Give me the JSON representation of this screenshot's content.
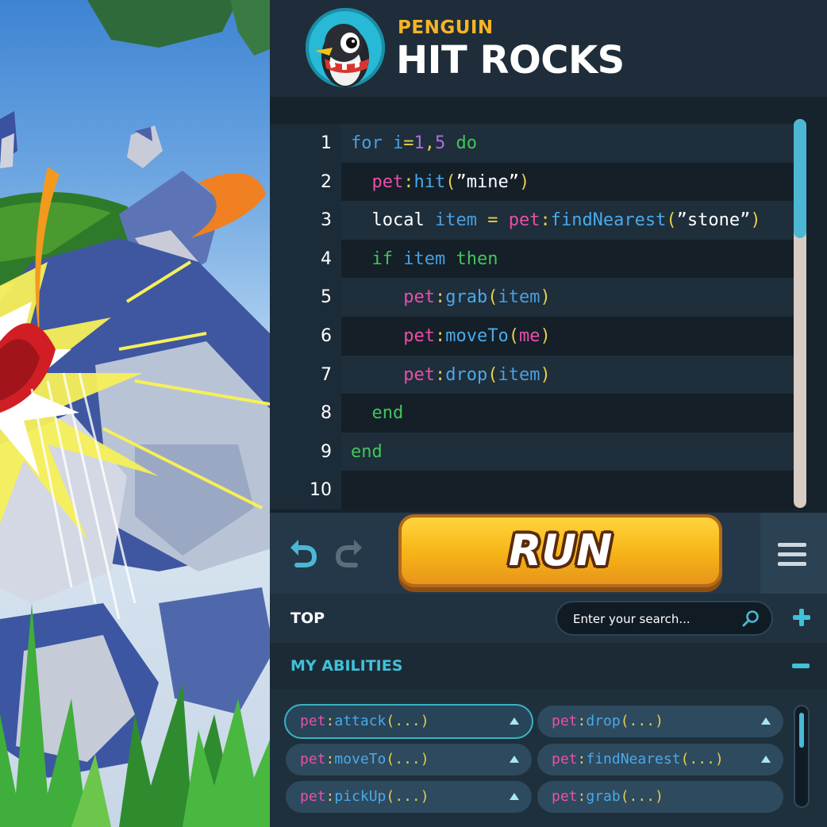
{
  "header": {
    "subtitle": "PENGUIN",
    "title": "HIT ROCKS",
    "avatar_icon": "penguin-avatar-icon"
  },
  "editor": {
    "lines": [
      {
        "num": "1",
        "tokens": [
          [
            "for",
            "for"
          ],
          [
            "plain",
            " "
          ],
          [
            "var",
            "i"
          ],
          [
            "punc",
            "="
          ],
          [
            "num",
            "1"
          ],
          [
            "punc",
            ","
          ],
          [
            "num",
            "5"
          ],
          [
            "plain",
            " "
          ],
          [
            "kw",
            "do"
          ]
        ]
      },
      {
        "num": "2",
        "tokens": [
          [
            "plain",
            "  "
          ],
          [
            "pet",
            "pet"
          ],
          [
            "punc",
            ":"
          ],
          [
            "fn",
            "hit"
          ],
          [
            "punc",
            "("
          ],
          [
            "str",
            "”mine”"
          ],
          [
            "punc",
            ")"
          ]
        ]
      },
      {
        "num": "3",
        "tokens": [
          [
            "plain",
            "  local "
          ],
          [
            "var",
            "item"
          ],
          [
            "plain",
            " "
          ],
          [
            "punc",
            "="
          ],
          [
            "plain",
            " "
          ],
          [
            "pet",
            "pet"
          ],
          [
            "punc",
            ":"
          ],
          [
            "fn",
            "findNearest"
          ],
          [
            "punc",
            "("
          ],
          [
            "str",
            "”stone”"
          ],
          [
            "punc",
            ")"
          ]
        ]
      },
      {
        "num": "4",
        "tokens": [
          [
            "plain",
            "  "
          ],
          [
            "kw",
            "if"
          ],
          [
            "plain",
            " "
          ],
          [
            "var",
            "item"
          ],
          [
            "plain",
            " "
          ],
          [
            "kw",
            "then"
          ]
        ]
      },
      {
        "num": "5",
        "tokens": [
          [
            "plain",
            "     "
          ],
          [
            "pet",
            "pet"
          ],
          [
            "punc",
            ":"
          ],
          [
            "fn",
            "grab"
          ],
          [
            "punc",
            "("
          ],
          [
            "var",
            "item"
          ],
          [
            "punc",
            ")"
          ]
        ]
      },
      {
        "num": "6",
        "tokens": [
          [
            "plain",
            "     "
          ],
          [
            "pet",
            "pet"
          ],
          [
            "punc",
            ":"
          ],
          [
            "fn",
            "moveTo"
          ],
          [
            "punc",
            "("
          ],
          [
            "pet",
            "me"
          ],
          [
            "punc",
            ")"
          ]
        ]
      },
      {
        "num": "7",
        "tokens": [
          [
            "plain",
            "     "
          ],
          [
            "pet",
            "pet"
          ],
          [
            "punc",
            ":"
          ],
          [
            "fn",
            "drop"
          ],
          [
            "punc",
            "("
          ],
          [
            "var",
            "item"
          ],
          [
            "punc",
            ")"
          ]
        ]
      },
      {
        "num": "8",
        "tokens": [
          [
            "plain",
            "  "
          ],
          [
            "kw",
            "end"
          ]
        ]
      },
      {
        "num": "9",
        "tokens": [
          [
            "kw",
            "end"
          ]
        ]
      },
      {
        "num": "10",
        "tokens": []
      }
    ]
  },
  "toolbar": {
    "run_label": "RUN",
    "undo_icon": "undo-icon",
    "redo_icon": "redo-icon",
    "menu_icon": "hamburger-menu-icon"
  },
  "search": {
    "section_label": "TOP",
    "placeholder": "Enter your search..."
  },
  "abilities": {
    "label": "MY ABILITIES",
    "items": [
      {
        "obj": "pet",
        "fn": "attack",
        "args": "(...)",
        "selected": true
      },
      {
        "obj": "pet",
        "fn": "drop",
        "args": "(...)",
        "selected": false
      },
      {
        "obj": "pet",
        "fn": "moveTo",
        "args": "(...)",
        "selected": false
      },
      {
        "obj": "pet",
        "fn": "findNearest",
        "args": "(...)",
        "selected": false
      },
      {
        "obj": "pet",
        "fn": "pickUp",
        "args": "(...)",
        "selected": false
      },
      {
        "obj": "pet",
        "fn": "grab",
        "args": "(...)",
        "selected": false
      }
    ]
  },
  "colors": {
    "accent_cyan": "#3fc1d9",
    "keyword_green": "#44c45a",
    "pet_pink": "#ea4fa8",
    "function_blue": "#4aa9e8",
    "run_yellow": "#f6b317",
    "subtitle_orange": "#f6b325"
  }
}
